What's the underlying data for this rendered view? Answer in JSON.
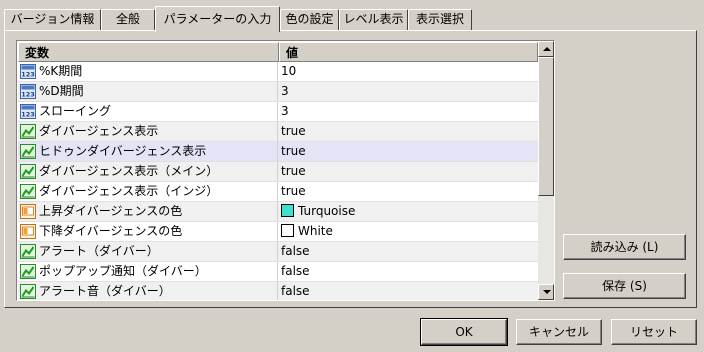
{
  "tabs": [
    {
      "label": "バージョン情報",
      "active": false
    },
    {
      "label": "全般",
      "active": false
    },
    {
      "label": "パラメーターの入力",
      "active": true
    },
    {
      "label": "色の設定",
      "active": false
    },
    {
      "label": "レベル表示",
      "active": false
    },
    {
      "label": "表示選択",
      "active": false
    }
  ],
  "table": {
    "headers": {
      "name": "変数",
      "value": "値"
    },
    "rows": [
      {
        "icon": "number-icon",
        "name": "%K期間",
        "value": "10"
      },
      {
        "icon": "number-icon",
        "name": "%D期間",
        "value": "3"
      },
      {
        "icon": "number-icon",
        "name": "スローイング",
        "value": "3"
      },
      {
        "icon": "bool-icon",
        "name": "ダイバージェンス表示",
        "value": "true"
      },
      {
        "icon": "bool-icon",
        "name": "ヒドゥンダイバージェンス表示",
        "value": "true",
        "selected": true
      },
      {
        "icon": "bool-icon",
        "name": "ダイバージェンス表示（メイン）",
        "value": "true"
      },
      {
        "icon": "bool-icon",
        "name": "ダイバージェンス表示（インジ）",
        "value": "true"
      },
      {
        "icon": "color-icon",
        "name": "上昇ダイバージェンスの色",
        "value": "Turquoise",
        "swatch": "#40e0d0"
      },
      {
        "icon": "color-icon",
        "name": "下降ダイバージェンスの色",
        "value": "White",
        "swatch": "#ffffff"
      },
      {
        "icon": "bool-icon",
        "name": "アラート（ダイバー）",
        "value": "false"
      },
      {
        "icon": "bool-icon",
        "name": "ポップアップ通知（ダイバー）",
        "value": "false"
      },
      {
        "icon": "bool-icon",
        "name": "アラート音（ダイバー）",
        "value": "false"
      }
    ]
  },
  "side_buttons": {
    "load": "読み込み (L)",
    "save": "保存 (S)"
  },
  "footer_buttons": {
    "ok": "OK",
    "cancel": "キャンセル",
    "reset": "リセット"
  },
  "colors": {
    "selected_row": "#e4e4f6",
    "dialog_bg": "#d4d0c8"
  }
}
